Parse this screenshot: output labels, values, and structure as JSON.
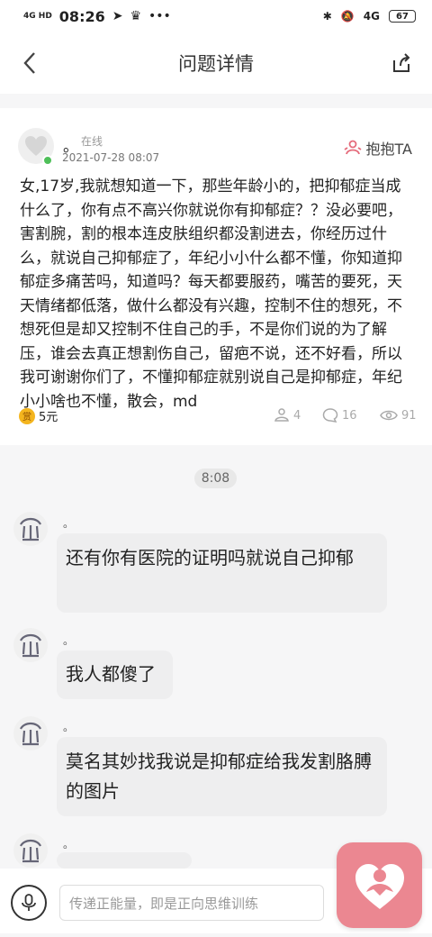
{
  "status_bar": {
    "network": "4G HD",
    "time": "08:26",
    "battery": "67",
    "signal_right": "4G"
  },
  "nav": {
    "title": "问题详情"
  },
  "question": {
    "username": "。",
    "online_status": "在线",
    "date": "2021-07-28 08:07",
    "hug_label": "抱抱TA",
    "body": "女,17岁,我就想知道一下，那些年龄小的，把抑郁症当成什么了，你有点不高兴你就说你有抑郁症？？没必要吧，害割腕，割的根本连皮肤组织都没割进去，你经历过什么，就说自己抑郁症了，年纪小小什么都不懂，你知道抑郁症多痛苦吗，知道吗？每天都要服药，嘴苦的要死，天天情绪都低落，做什么都没有兴趣，控制不住的想死，不想死但是却又控制不住自己的手，不是你们说的为了解压，谁会去真正想割伤自己，留疤不说，还不好看，所以我可谢谢你们了，不懂抑郁症就别说自己是抑郁症，年纪小小啥也不懂，散会，md",
    "reward_icon": "赏",
    "reward": "5元",
    "stats": {
      "hugs": "4",
      "comments": "16",
      "views": "91"
    }
  },
  "chat": {
    "time_divider": "8:08",
    "messages": [
      {
        "name": "。",
        "text": "还有你有医院的证明吗就说自己抑郁"
      },
      {
        "name": "。",
        "text": "我人都傻了"
      },
      {
        "name": "。",
        "text": "莫名其妙找我说是抑郁症给我发割胳膊的图片"
      },
      {
        "name": "。",
        "text": ""
      }
    ]
  },
  "input": {
    "placeholder": "传递正能量，即是正向思维训练"
  },
  "colors": {
    "accent": "#eb8791",
    "online": "#4ebf59",
    "coin": "#f4b51e"
  }
}
